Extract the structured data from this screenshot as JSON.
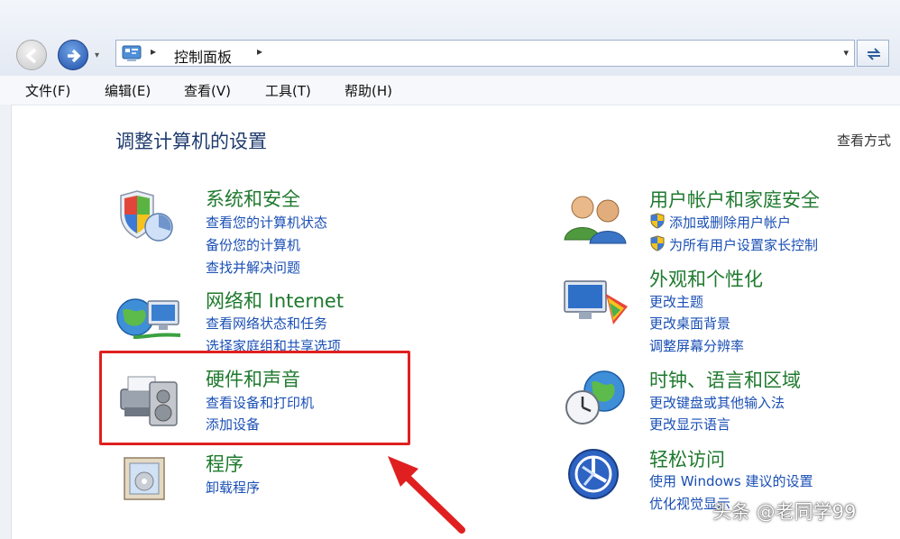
{
  "address_bar": {
    "path_label": "控制面板",
    "separator": "▸",
    "dropdown_glyph": "▾"
  },
  "menu": {
    "items": [
      "文件(F)",
      "编辑(E)",
      "查看(V)",
      "工具(T)",
      "帮助(H)"
    ]
  },
  "main": {
    "title": "调整计算机的设置",
    "view_by": "查看方式"
  },
  "categories": [
    {
      "title": "系统和安全",
      "icon": "shield-icon",
      "links": [
        "查看您的计算机状态",
        "备份您的计算机",
        "查找并解决问题"
      ]
    },
    {
      "title": "网络和 Internet",
      "icon": "network-globe-icon",
      "links": [
        "查看网络状态和任务",
        "选择家庭组和共享选项"
      ]
    },
    {
      "title": "硬件和声音",
      "icon": "printer-speaker-icon",
      "links": [
        "查看设备和打印机",
        "添加设备"
      ]
    },
    {
      "title": "程序",
      "icon": "programs-box-icon",
      "links": [
        "卸载程序"
      ]
    },
    {
      "title": "用户帐户和家庭安全",
      "icon": "users-icon",
      "links": [
        "添加或删除用户帐户",
        "为所有用户设置家长控制"
      ]
    },
    {
      "title": "外观和个性化",
      "icon": "monitor-palette-icon",
      "links": [
        "更改主题",
        "更改桌面背景",
        "调整屏幕分辨率"
      ]
    },
    {
      "title": "时钟、语言和区域",
      "icon": "clock-globe-icon",
      "links": [
        "更改键盘或其他输入法",
        "更改显示语言"
      ]
    },
    {
      "title": "轻松访问",
      "icon": "ease-of-access-icon",
      "links": [
        "使用 Windows 建议的设置",
        "优化视觉显示"
      ]
    }
  ],
  "annotation": {
    "highlight_color": "#e02020"
  },
  "watermark": "头条 @老同学99"
}
